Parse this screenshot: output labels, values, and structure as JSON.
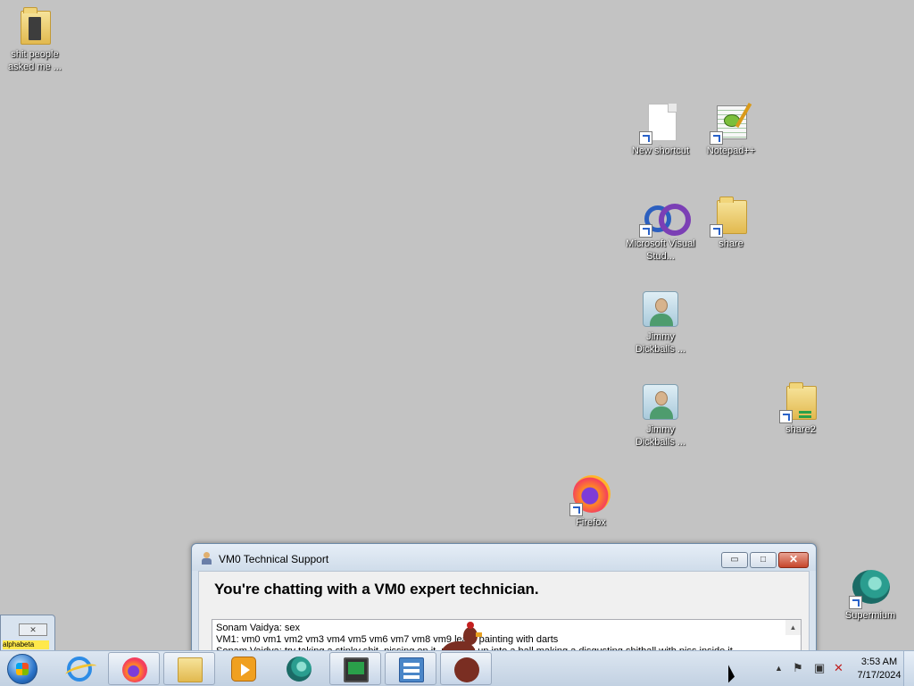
{
  "desktop": {
    "icons": [
      {
        "id": "folder-people",
        "label": "shit people asked me ..."
      },
      {
        "id": "new-shortcut",
        "label": "New shortcut"
      },
      {
        "id": "notepadpp",
        "label": "Notepad++"
      },
      {
        "id": "visual-studio",
        "label": "Microsoft Visual Stud..."
      },
      {
        "id": "share",
        "label": "share"
      },
      {
        "id": "jimmy1",
        "label": "Jimmy Dickballs ..."
      },
      {
        "id": "jimmy2",
        "label": "Jimmy Dickballs ..."
      },
      {
        "id": "share2",
        "label": "share2"
      },
      {
        "id": "firefox",
        "label": "Firefox"
      },
      {
        "id": "supermium",
        "label": "Supermium"
      }
    ]
  },
  "chat_window": {
    "title": "VM0 Technical Support",
    "headline": "You're chatting with a VM0 expert technician.",
    "controls": {
      "minimize": "▭",
      "maximize": "□",
      "close": "✕"
    },
    "messages": [
      "Sonam Vaidya: sex",
      "VM1: vm0 vm1 vm2 vm3 vm4 vm5 vm6 vm7 vm8 vm9 learn painting with darts",
      "Sonam Vaidya: try taking a stinky shit, pissing on it, rolling it up into a ball making a disgusting shitball with piss inside it"
    ]
  },
  "mini_window": {
    "close_label": "✕",
    "ticker": "alphabeta"
  },
  "taskbar": {
    "items": [
      {
        "id": "ie",
        "icon": "internet-explorer-icon"
      },
      {
        "id": "firefox",
        "icon": "firefox-icon"
      },
      {
        "id": "explorer",
        "icon": "folder-icon"
      },
      {
        "id": "media-player",
        "icon": "media-player-icon"
      },
      {
        "id": "supermium",
        "icon": "supermium-icon"
      },
      {
        "id": "task-manager",
        "icon": "monitor-icon"
      },
      {
        "id": "control-panel",
        "icon": "control-panel-icon"
      },
      {
        "id": "chicken",
        "icon": "chicken-icon"
      }
    ],
    "clock": {
      "time": "3:53 AM",
      "date": "7/17/2024"
    }
  }
}
